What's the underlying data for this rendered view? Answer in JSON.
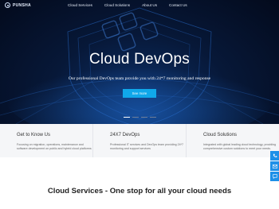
{
  "brand": {
    "name": "PUNSHA"
  },
  "nav": {
    "items": [
      {
        "label": "Cloud Services"
      },
      {
        "label": "Cloud Solutions"
      },
      {
        "label": "About Us"
      },
      {
        "label": "Contact Us"
      }
    ]
  },
  "hero": {
    "title": "Cloud DevOps",
    "subtitle": "Our professional DevOps team provide you with 24*7 monitoring and response",
    "button_label": "See more",
    "carousel": {
      "slides": 4,
      "active_index": 0
    }
  },
  "features": [
    {
      "title": "Get to Know Us",
      "description": "Focusing on migration, operations, maintenance and software development on public and hybrid cloud platforms"
    },
    {
      "title": "24X7 DevOps",
      "description": "Professional IT services and DevOps team providing 24*7 monitoring and support services"
    },
    {
      "title": "Cloud Solutions",
      "description": "Integrated with global leading cloud technology, providing comprehensive custom solutions to meet your needs."
    }
  ],
  "side_contact": {
    "icons": [
      "phone-icon",
      "mail-icon",
      "chat-icon"
    ],
    "color": "#1e90e8"
  },
  "section": {
    "title_strong": "Cloud Services",
    "title_rest": " - One stop for all your cloud needs"
  },
  "colors": {
    "accent": "#10a8ea",
    "hero_bg": "#071838"
  }
}
